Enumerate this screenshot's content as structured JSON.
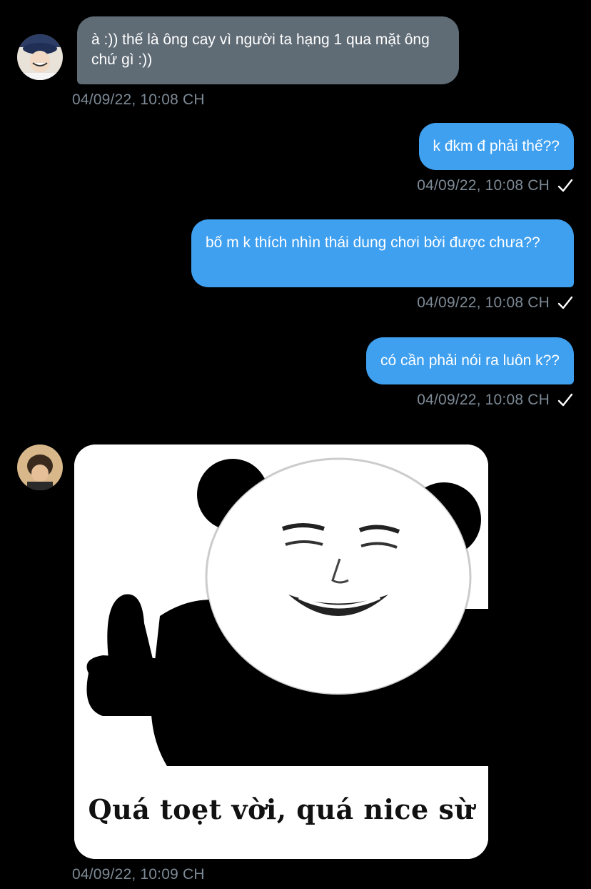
{
  "messages": [
    {
      "direction": "incoming",
      "text": "à :)) thế là ông cay vì người ta hạng 1 qua mặt ông chứ gì :))",
      "timestamp": "04/09/22, 10:08 CH"
    },
    {
      "direction": "outgoing",
      "text": "k đkm đ phải thế??",
      "timestamp": "04/09/22, 10:08 CH",
      "status_icon": "checkmark-icon"
    },
    {
      "direction": "outgoing",
      "text": "bố m k thích nhìn thái dung chơi bời được chưa??",
      "timestamp": "04/09/22, 10:08 CH",
      "status_icon": "checkmark-icon"
    },
    {
      "direction": "outgoing",
      "text": "có cần phải nói ra luôn k??",
      "timestamp": "04/09/22, 10:08 CH",
      "status_icon": "checkmark-icon"
    },
    {
      "direction": "incoming",
      "type": "image",
      "image_caption": "Quá toẹt vời, quá nice sừ",
      "timestamp": "04/09/22, 10:09 CH"
    }
  ],
  "colors": {
    "background": "#000000",
    "incoming_bubble": "#5f6b75",
    "outgoing_bubble": "#3fa0f0",
    "timestamp": "#7d8a96"
  }
}
